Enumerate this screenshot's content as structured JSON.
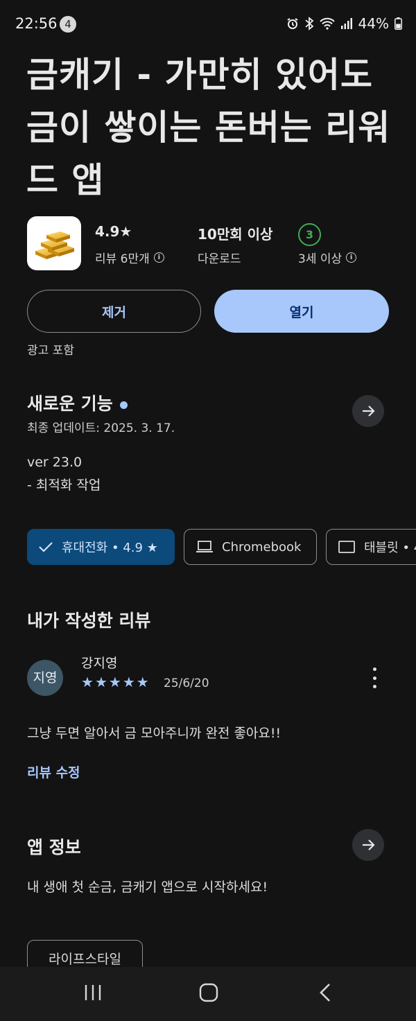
{
  "status_bar": {
    "time": "22:56",
    "notification_count": "4",
    "battery": "44%"
  },
  "app": {
    "title": "금캐기 - 가만히 있어도 금이 쌓이는 돈버는 리워드 앱",
    "rating": "4.9★",
    "reviews_label": "리뷰 6만개",
    "downloads": "10만회 이상",
    "downloads_label": "다운로드",
    "age_badge": "3",
    "age_label": "3세 이상"
  },
  "actions": {
    "remove_label": "제거",
    "open_label": "열기",
    "ads_notice": "광고 포함"
  },
  "whats_new": {
    "title": "새로운 기능",
    "last_update": "최종 업데이트: 2025. 3. 17.",
    "version": "ver 23.0",
    "notes": "- 최적화 작업"
  },
  "devices": {
    "phone": "휴대전화 • 4.9 ★",
    "chromebook": "Chromebook",
    "tablet": "태블릿 • 4"
  },
  "my_review": {
    "title": "내가 작성한 리뷰",
    "avatar_text": "지영",
    "author": "강지영",
    "stars": 5,
    "date": "25/6/20",
    "text": "그냥 두면 알아서 금 모아주니까 완전 좋아요!!",
    "edit_label": "리뷰 수정"
  },
  "app_info": {
    "title": "앱 정보",
    "description": "내 생애 첫 순금, 금캐기 앱으로 시작하세요!",
    "category_tag": "라이프스타일"
  },
  "colors": {
    "background": "#131314",
    "accent": "#a8c7fa",
    "chip_selected": "#0b4a7a",
    "age_green": "#3fae55"
  },
  "icons": [
    "alarm-icon",
    "bluetooth-icon",
    "wifi-icon",
    "signal-icon",
    "battery-icon",
    "info-icon",
    "arrow-right-icon",
    "check-icon",
    "laptop-icon",
    "tablet-icon",
    "kebab-icon",
    "recents-icon",
    "home-icon",
    "back-icon"
  ]
}
